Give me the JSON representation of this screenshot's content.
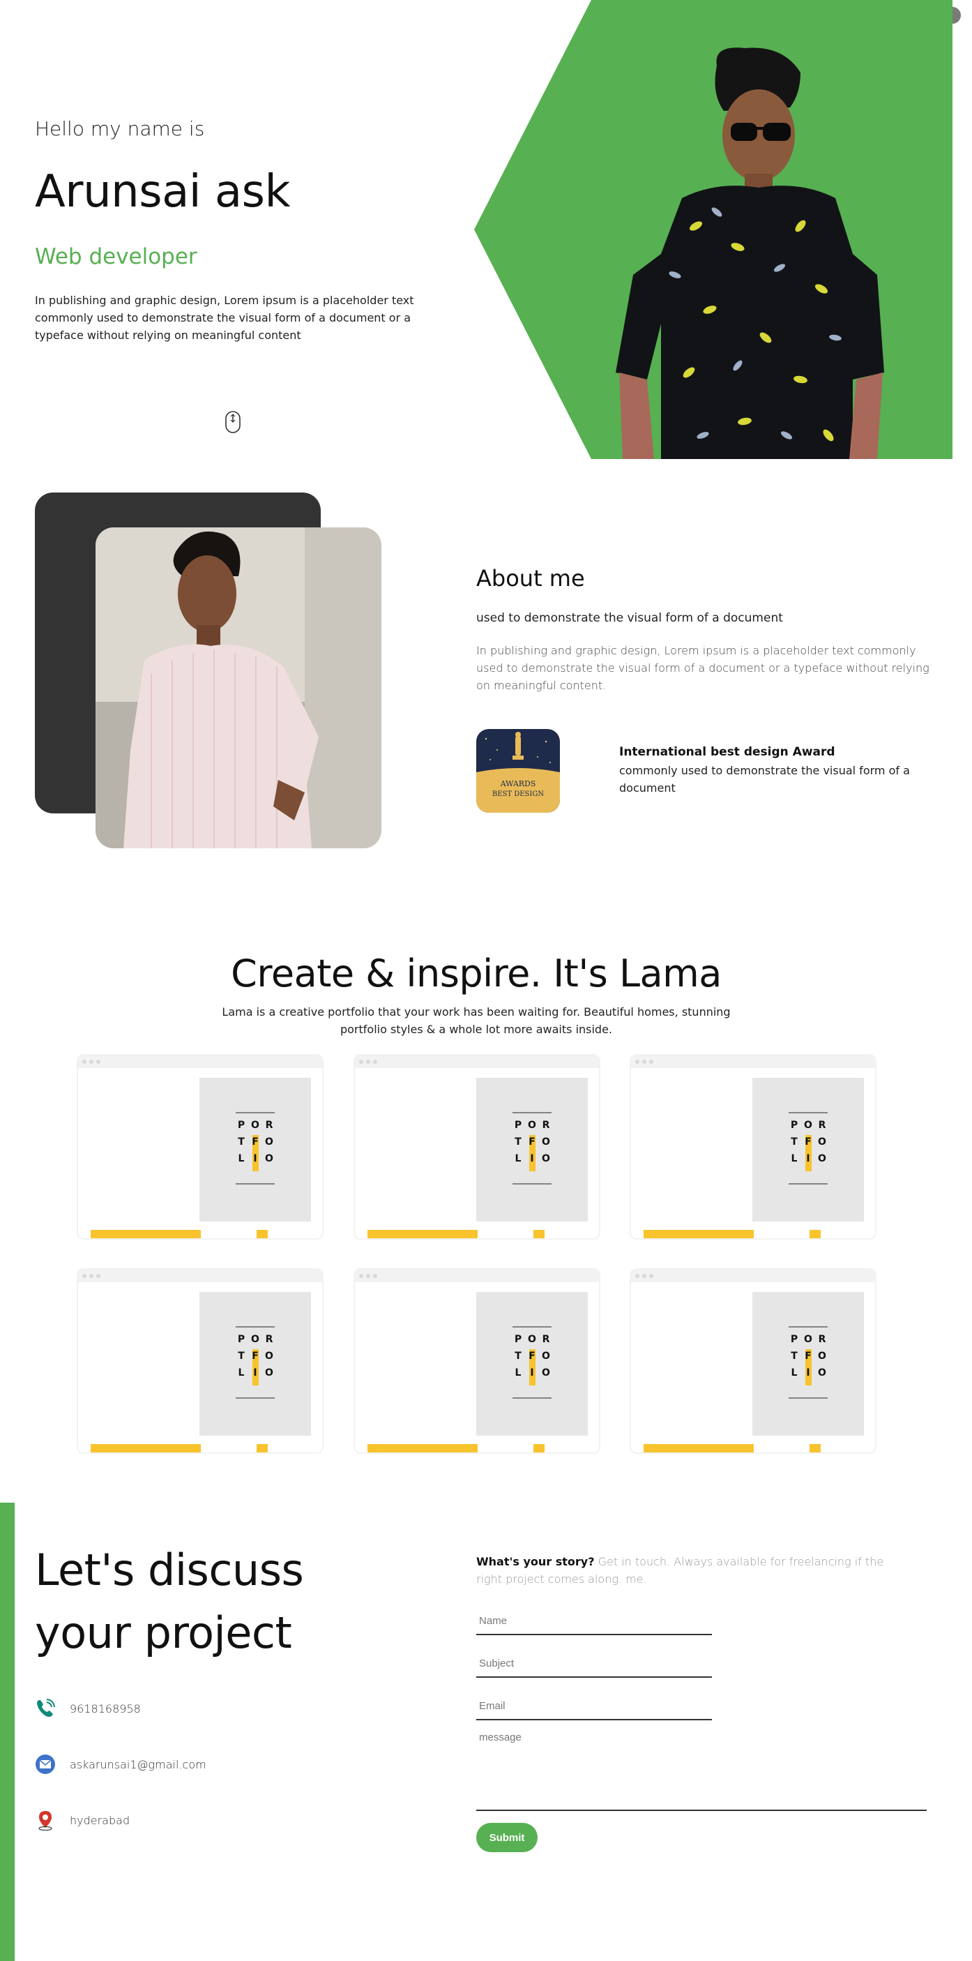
{
  "colors": {
    "accent": "#57b052",
    "dark_card": "#333333",
    "poster_yellow": "#f8c32c"
  },
  "hero": {
    "intro": "Hello my name is",
    "name": "Arunsai ask",
    "role": "Web developer",
    "description": "In publishing and graphic design, Lorem ipsum is a placeholder text commonly used to demonstrate the visual form of a document or a typeface without relying on meaningful content",
    "scroll_icon": "mouse-scroll-icon"
  },
  "about": {
    "title": "About me",
    "subtitle": "used to demonstrate the visual form of a document",
    "description": "In publishing and graphic design, Lorem ipsum is a placeholder text commonly used to demonstrate the visual form of a document or a typeface without relying on meaningful content.",
    "award": {
      "image_text_1": "AWARDS",
      "image_text_2": "BEST DESIGN",
      "title": "International best design Award",
      "description": "commonly used to demonstrate the visual form of a document"
    }
  },
  "portfolio": {
    "title": "Create & inspire. It's Lama",
    "description": "Lama is a creative portfolio that your work has been waiting for. Beautiful homes, stunning portfolio styles & a whole lot more awaits inside.",
    "poster_letters": [
      "P",
      "O",
      "R",
      "T",
      "F",
      "O",
      "L",
      "I",
      "O"
    ],
    "items": [
      {},
      {},
      {},
      {},
      {},
      {}
    ]
  },
  "contact": {
    "title_line1": "Let's discuss",
    "title_line2": "your project",
    "items": [
      {
        "icon": "phone-icon",
        "text": "9618168958"
      },
      {
        "icon": "email-icon",
        "text": "askarunsai1@gmail.com"
      },
      {
        "icon": "location-pin-icon",
        "text": "hyderabad"
      }
    ],
    "story_bold": "What's your story?",
    "story_text": " Get in touch. Always available for freelancing if the right project comes along. me.",
    "form": {
      "name_placeholder": "Name",
      "subject_placeholder": "Subject",
      "email_placeholder": "Email",
      "message_placeholder": "message",
      "submit_label": "Submit"
    }
  }
}
